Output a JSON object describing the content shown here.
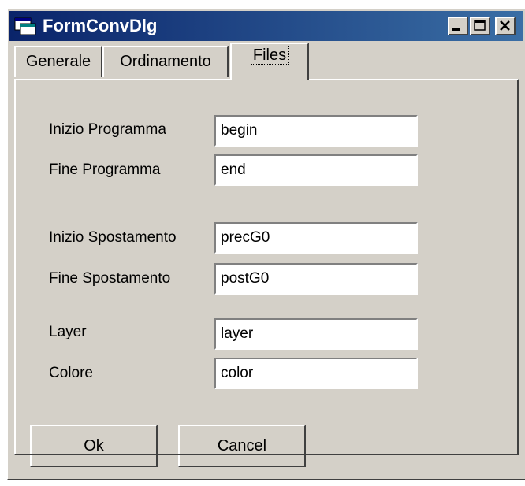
{
  "window": {
    "title": "FormConvDlg",
    "icon": "app-window-icon"
  },
  "titlebar_buttons": [
    {
      "name": "minimize",
      "icon": "minimize-icon"
    },
    {
      "name": "maximize",
      "icon": "maximize-icon"
    },
    {
      "name": "close",
      "icon": "close-icon"
    }
  ],
  "tabs": [
    {
      "label": "Generale",
      "active": false
    },
    {
      "label": "Ordinamento",
      "active": false
    },
    {
      "label": "Files",
      "active": true
    }
  ],
  "fields": [
    {
      "label": "Inizio Programma",
      "value": "begin"
    },
    {
      "label": "Fine Programma",
      "value": "end"
    },
    {
      "label": "Inizio Spostamento",
      "value": "precG0"
    },
    {
      "label": "Fine Spostamento",
      "value": "postG0"
    },
    {
      "label": "Layer",
      "value": "layer"
    },
    {
      "label": "Colore",
      "value": "color"
    }
  ],
  "buttons": {
    "ok": "Ok",
    "cancel": "Cancel"
  },
  "colors": {
    "titlebar_start": "#0a246a",
    "titlebar_end": "#3a6ea5",
    "face": "#d4d0c8"
  }
}
